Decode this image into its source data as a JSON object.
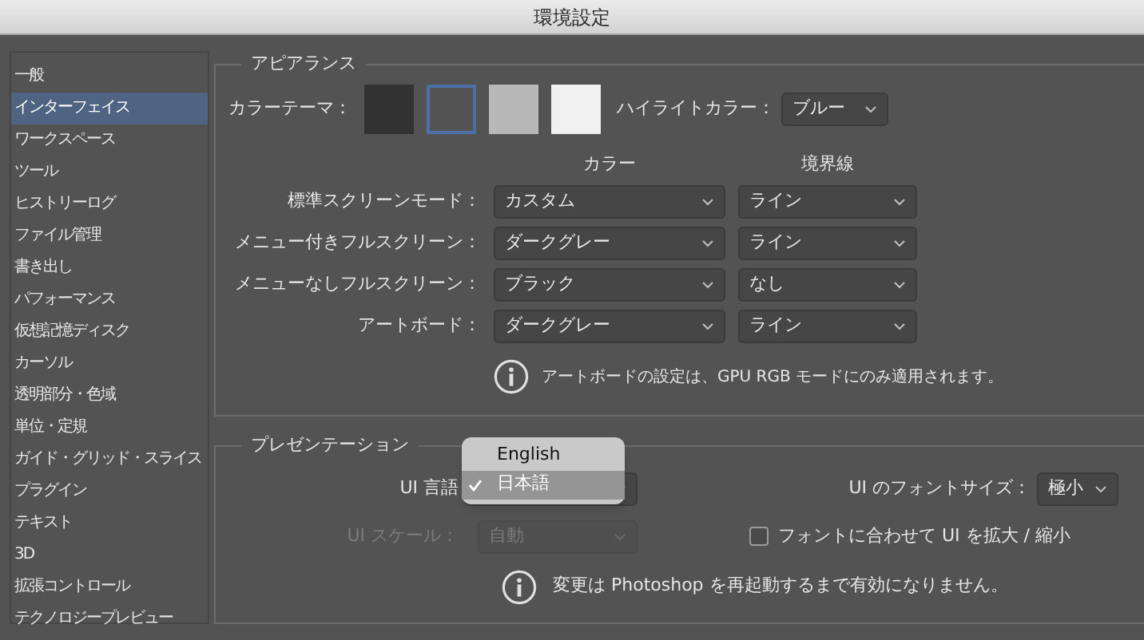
{
  "window": {
    "title": "環境設定"
  },
  "sidebar": {
    "items": [
      {
        "label": "一般",
        "selected": false
      },
      {
        "label": "インターフェイス",
        "selected": true
      },
      {
        "label": "ワークスペース",
        "selected": false
      },
      {
        "label": "ツール",
        "selected": false
      },
      {
        "label": "ヒストリーログ",
        "selected": false
      },
      {
        "label": "ファイル管理",
        "selected": false
      },
      {
        "label": "書き出し",
        "selected": false
      },
      {
        "label": "パフォーマンス",
        "selected": false
      },
      {
        "label": "仮想記憶ディスク",
        "selected": false
      },
      {
        "label": "カーソル",
        "selected": false
      },
      {
        "label": "透明部分・色域",
        "selected": false
      },
      {
        "label": "単位・定規",
        "selected": false
      },
      {
        "label": "ガイド・グリッド・スライス",
        "selected": false
      },
      {
        "label": "プラグイン",
        "selected": false
      },
      {
        "label": "テキスト",
        "selected": false
      },
      {
        "label": "3D",
        "selected": false
      },
      {
        "label": "拡張コントロール",
        "selected": false
      },
      {
        "label": "テクノロジープレビュー",
        "selected": false
      }
    ]
  },
  "appearance": {
    "title": "アピアランス",
    "color_theme": {
      "label": "カラーテーマ：",
      "swatches": [
        {
          "color": "#323232",
          "selected": false
        },
        {
          "color": "#535353",
          "selected": true
        },
        {
          "color": "#b8b8b8",
          "selected": false
        },
        {
          "color": "#f0f0f0",
          "selected": false
        }
      ]
    },
    "highlight": {
      "label": "ハイライトカラー：",
      "value": "ブルー"
    },
    "columns": [
      "カラー",
      "境界線"
    ],
    "rows": [
      {
        "label": "標準スクリーンモード：",
        "color_choice": "カスタム",
        "border_choice": "ライン"
      },
      {
        "label": "メニュー付きフルスクリーン：",
        "color_choice": "ダークグレー",
        "border_choice": "ライン"
      },
      {
        "label": "メニューなしフルスクリーン：",
        "color_choice": "ブラック",
        "border_choice": "なし"
      },
      {
        "label": "アートボード：",
        "color_choice": "ダークグレー",
        "border_choice": "ライン"
      }
    ],
    "note": "アートボードの設定は、GPU RGB モードにのみ適用されます。"
  },
  "presentation": {
    "title": "プレゼンテーション",
    "ui_language": {
      "label": "UI 言語",
      "options": [
        {
          "label": "English",
          "selected": false
        },
        {
          "label": "日本語",
          "selected": true
        }
      ]
    },
    "font_size": {
      "label": "UI のフォントサイズ：",
      "value": "極小"
    },
    "ui_scale": {
      "label": "UI スケール：",
      "value": "自動",
      "disabled": true
    },
    "scale_with_font": {
      "label": "フォントに合わせて UI を拡大 / 縮小",
      "checked": false
    },
    "note": "変更は Photoshop を再起動するまで有効になりません。"
  }
}
